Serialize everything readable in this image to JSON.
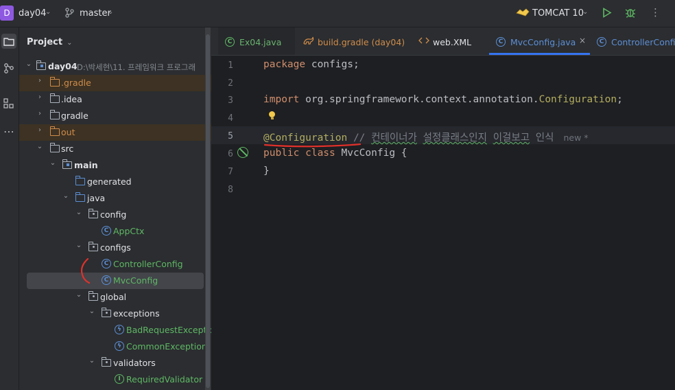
{
  "topbar": {
    "project_badge": "D",
    "project_name": "day04",
    "branch_name": "master",
    "run_config": "TOMCAT 10",
    "icons": [
      "chevron-down-icon",
      "branch-icon",
      "tomcat-icon",
      "run-icon",
      "debug-icon",
      "more-icon"
    ]
  },
  "left_strip": {
    "icons": [
      "project-folder-icon",
      "commit-icon",
      "structure-icon",
      "more-icon"
    ]
  },
  "project_panel": {
    "title": "Project",
    "tree": [
      {
        "label": "day04",
        "path": "D:\\박세현\\11. 프레임워크 프로그래",
        "style": "bold",
        "icon": "module-folder-icon"
      },
      {
        "label": ".gradle",
        "style": "orange",
        "icon": "excluded-folder-icon"
      },
      {
        "label": ".idea",
        "style": "normal",
        "icon": "folder-icon"
      },
      {
        "label": "gradle",
        "style": "normal",
        "icon": "folder-icon"
      },
      {
        "label": "out",
        "style": "orange",
        "icon": "excluded-folder-icon"
      },
      {
        "label": "src",
        "style": "normal",
        "icon": "folder-icon"
      },
      {
        "label": "main",
        "style": "bold",
        "icon": "module-folder-icon"
      },
      {
        "label": "generated",
        "style": "normal",
        "icon": "generated-folder-icon"
      },
      {
        "label": "java",
        "style": "normal",
        "icon": "source-folder-icon"
      },
      {
        "label": "config",
        "style": "normal",
        "icon": "package-icon"
      },
      {
        "label": "AppCtx",
        "style": "class",
        "icon": "class-icon"
      },
      {
        "label": "configs",
        "style": "normal",
        "icon": "package-icon"
      },
      {
        "label": "ControllerConfig",
        "style": "class",
        "icon": "class-icon"
      },
      {
        "label": "MvcConfig",
        "style": "class",
        "icon": "class-icon"
      },
      {
        "label": "global",
        "style": "normal",
        "icon": "package-icon"
      },
      {
        "label": "exceptions",
        "style": "normal",
        "icon": "package-icon"
      },
      {
        "label": "BadRequestException",
        "style": "class",
        "icon": "exception-class-icon"
      },
      {
        "label": "CommonException",
        "style": "class",
        "icon": "exception-class-icon"
      },
      {
        "label": "validators",
        "style": "normal",
        "icon": "package-icon"
      },
      {
        "label": "RequiredValidator",
        "style": "class",
        "icon": "interface-icon"
      }
    ]
  },
  "editor": {
    "tabs": [
      {
        "label": "Ex04.java",
        "color": "#6ab36f",
        "icon": "class-icon"
      },
      {
        "label": "build.gradle (day04)",
        "color": "#d08c4a",
        "icon": "gradle-icon"
      },
      {
        "label": "web.XML",
        "color": "#dfe1e5",
        "icon": "xml-icon"
      },
      {
        "label": "MvcConfig.java",
        "color": "#5d8fd6",
        "icon": "class-icon",
        "active": true,
        "close": "×"
      },
      {
        "label": "ControllerConfig.",
        "color": "#5d8fd6",
        "icon": "class-icon"
      }
    ],
    "line_numbers": [
      "1",
      "2",
      "3",
      "4",
      "5",
      "6",
      "7",
      "8"
    ],
    "code": {
      "l1_kw": "package",
      "l1_rest": " configs;",
      "l3_kw": "import",
      "l3_pkg": " org.springframework.context.annotation.",
      "l3_cls": "Configuration",
      "l3_end": ";",
      "l5_ann": "@Configuration",
      "l5_cmt_a": " // ",
      "l5_cmt_w1": "컨테이너가",
      "l5_cmt_sp1": " ",
      "l5_cmt_w2": "설정클래스인지",
      "l5_cmt_sp2": " ",
      "l5_cmt_w3": "이걸보고",
      "l5_cmt_w4": " 인식",
      "l5_hint": "new *",
      "l6_kw": "public class",
      "l6_rest": " MvcConfig {",
      "l7": "}"
    }
  },
  "colors": {
    "accent": "#3574f0",
    "annotation_mark": "#e0312b"
  }
}
